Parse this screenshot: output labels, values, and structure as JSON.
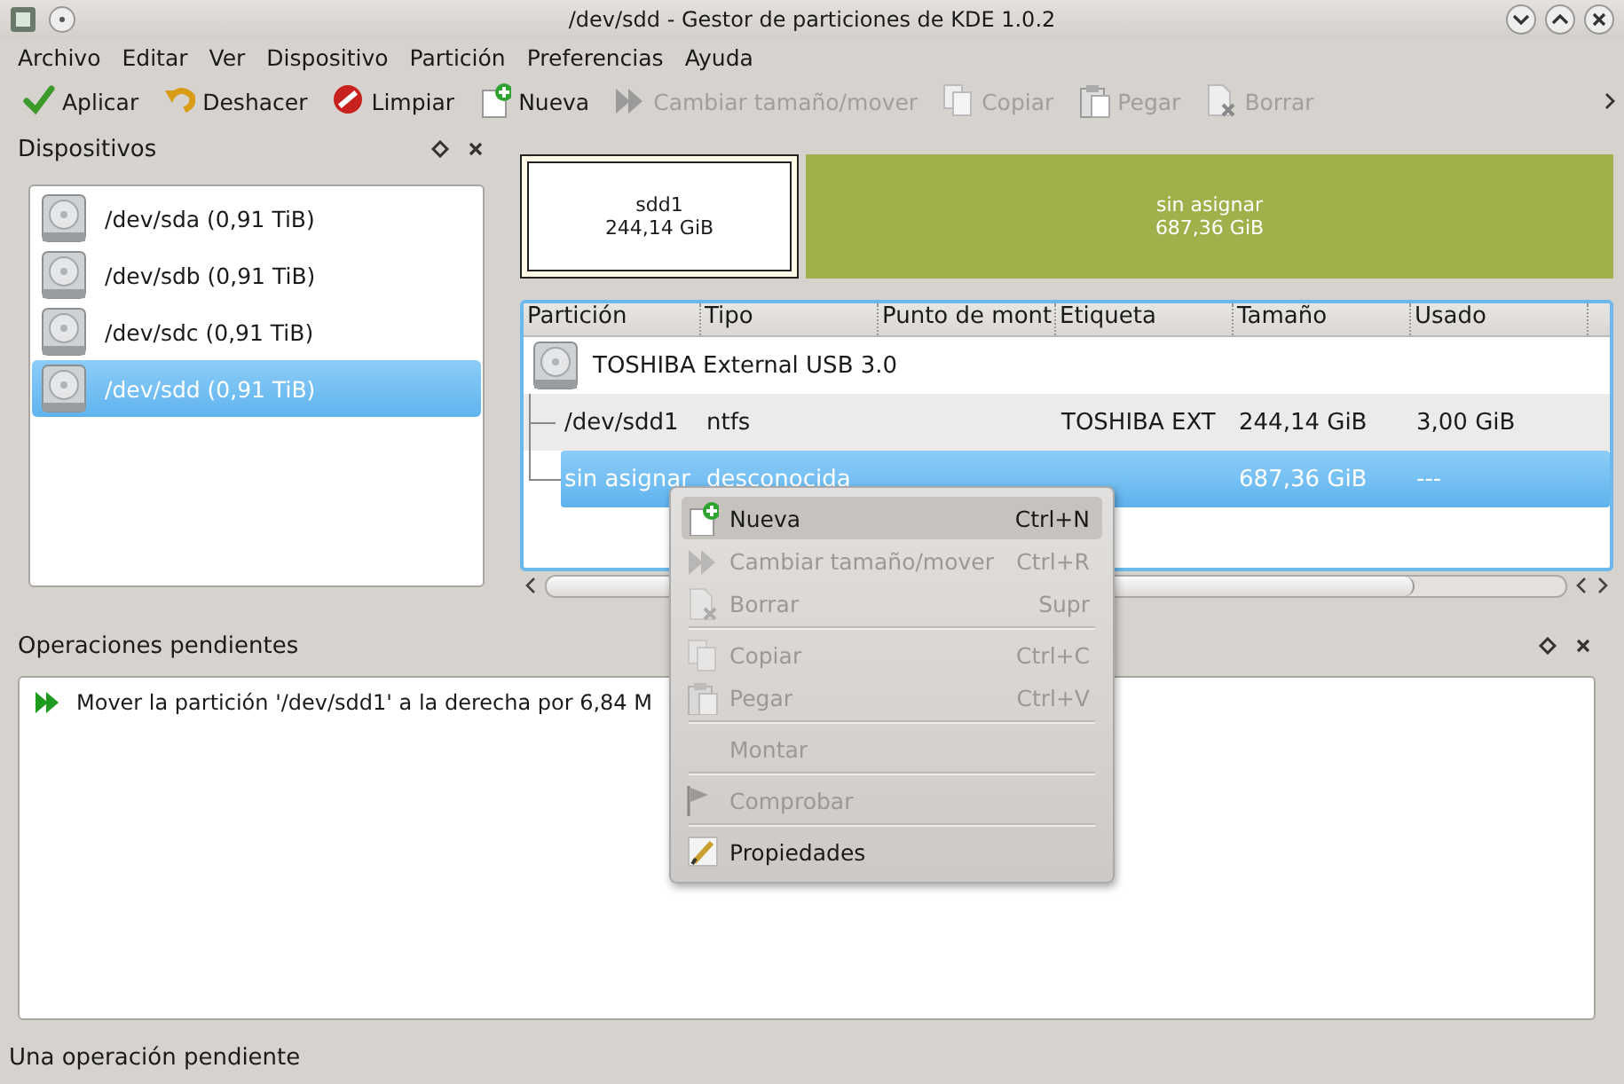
{
  "window": {
    "title": "/dev/sdd - Gestor de particiones de KDE 1.0.2"
  },
  "menubar": [
    "Archivo",
    "Editar",
    "Ver",
    "Dispositivo",
    "Partición",
    "Preferencias",
    "Ayuda"
  ],
  "toolbar": [
    {
      "label": "Aplicar",
      "disabled": false
    },
    {
      "label": "Deshacer",
      "disabled": false
    },
    {
      "label": "Limpiar",
      "disabled": false
    },
    {
      "label": "Nueva",
      "disabled": false
    },
    {
      "label": "Cambiar tamaño/mover",
      "disabled": true
    },
    {
      "label": "Copiar",
      "disabled": true
    },
    {
      "label": "Pegar",
      "disabled": true
    },
    {
      "label": "Borrar",
      "disabled": true
    }
  ],
  "devices": {
    "title": "Dispositivos",
    "items": [
      {
        "label": "/dev/sda (0,91 TiB)",
        "selected": false
      },
      {
        "label": "/dev/sdb (0,91 TiB)",
        "selected": false
      },
      {
        "label": "/dev/sdc (0,91 TiB)",
        "selected": false
      },
      {
        "label": "/dev/sdd (0,91 TiB)",
        "selected": true
      }
    ]
  },
  "disk_map": [
    {
      "kind": "partition",
      "name": "sdd1",
      "size": "244,14 GiB"
    },
    {
      "kind": "unallocated",
      "name": "sin asignar",
      "size": "687,36 GiB"
    }
  ],
  "partition_table": {
    "columns": [
      "Partición",
      "Tipo",
      "Punto de mont",
      "Etiqueta",
      "Tamaño",
      "Usado"
    ],
    "device": "TOSHIBA External USB 3.0",
    "rows": [
      {
        "partition": "/dev/sdd1",
        "type": "ntfs",
        "label": "TOSHIBA EXT",
        "size": "244,14 GiB",
        "used": "3,00 GiB",
        "selected": false
      },
      {
        "partition": "sin asignar",
        "type": "desconocida",
        "size": "687,36 GiB",
        "used": "---",
        "selected": true
      }
    ]
  },
  "operations": {
    "title": "Operaciones pendientes",
    "items": [
      "Mover la partición '/dev/sdd1' a la derecha por 6,84 M"
    ]
  },
  "context_menu": [
    [
      {
        "label": "Nueva",
        "shortcut": "Ctrl+N",
        "disabled": false,
        "selected": true
      },
      {
        "label": "Cambiar tamaño/mover",
        "shortcut": "Ctrl+R",
        "disabled": true,
        "selected": false
      },
      {
        "label": "Borrar",
        "shortcut": "Supr",
        "disabled": true,
        "selected": false
      }
    ],
    [
      {
        "label": "Copiar",
        "shortcut": "Ctrl+C",
        "disabled": true,
        "selected": false
      },
      {
        "label": "Pegar",
        "shortcut": "Ctrl+V",
        "disabled": true,
        "selected": false
      }
    ],
    [
      {
        "label": "Montar",
        "disabled": true,
        "selected": false
      }
    ],
    [
      {
        "label": "Comprobar",
        "disabled": true,
        "selected": false
      }
    ],
    [
      {
        "label": "Propiedades",
        "disabled": false,
        "selected": false
      }
    ]
  ],
  "status_bar": "Una operación pendiente"
}
